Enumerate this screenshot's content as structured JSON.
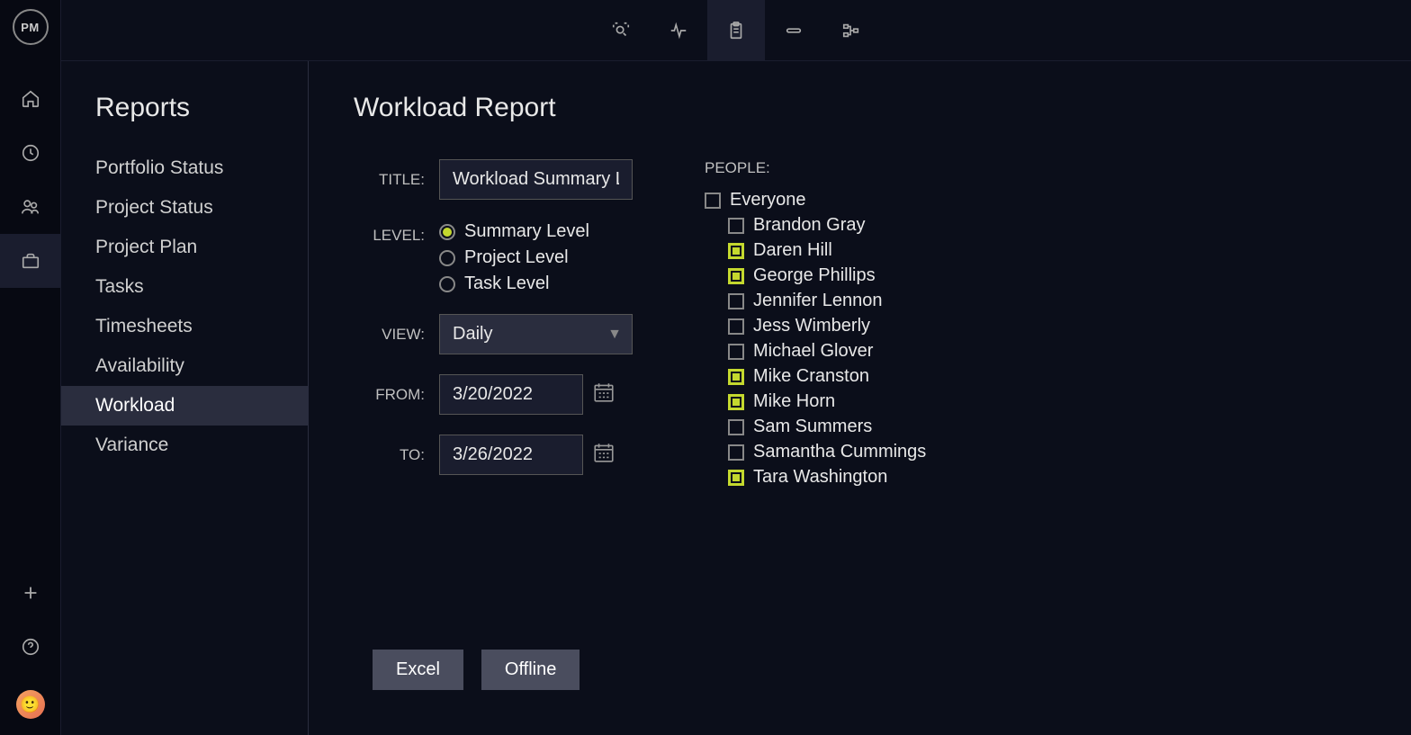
{
  "logo": "PM",
  "sidebar": {
    "title": "Reports",
    "items": [
      {
        "label": "Portfolio Status",
        "active": false
      },
      {
        "label": "Project Status",
        "active": false
      },
      {
        "label": "Project Plan",
        "active": false
      },
      {
        "label": "Tasks",
        "active": false
      },
      {
        "label": "Timesheets",
        "active": false
      },
      {
        "label": "Availability",
        "active": false
      },
      {
        "label": "Workload",
        "active": true
      },
      {
        "label": "Variance",
        "active": false
      }
    ]
  },
  "page": {
    "title": "Workload Report"
  },
  "form": {
    "title_label": "TITLE:",
    "title_value": "Workload Summary L",
    "level_label": "LEVEL:",
    "levels": [
      {
        "label": "Summary Level",
        "checked": true
      },
      {
        "label": "Project Level",
        "checked": false
      },
      {
        "label": "Task Level",
        "checked": false
      }
    ],
    "view_label": "VIEW:",
    "view_value": "Daily",
    "from_label": "FROM:",
    "from_value": "3/20/2022",
    "to_label": "TO:",
    "to_value": "3/26/2022"
  },
  "people": {
    "label": "PEOPLE:",
    "everyone": {
      "label": "Everyone",
      "checked": false
    },
    "list": [
      {
        "label": "Brandon Gray",
        "checked": false
      },
      {
        "label": "Daren Hill",
        "checked": true
      },
      {
        "label": "George Phillips",
        "checked": true
      },
      {
        "label": "Jennifer Lennon",
        "checked": false
      },
      {
        "label": "Jess Wimberly",
        "checked": false
      },
      {
        "label": "Michael Glover",
        "checked": false
      },
      {
        "label": "Mike Cranston",
        "checked": true
      },
      {
        "label": "Mike Horn",
        "checked": true
      },
      {
        "label": "Sam Summers",
        "checked": false
      },
      {
        "label": "Samantha Cummings",
        "checked": false
      },
      {
        "label": "Tara Washington",
        "checked": true
      }
    ]
  },
  "buttons": {
    "excel": "Excel",
    "offline": "Offline"
  }
}
